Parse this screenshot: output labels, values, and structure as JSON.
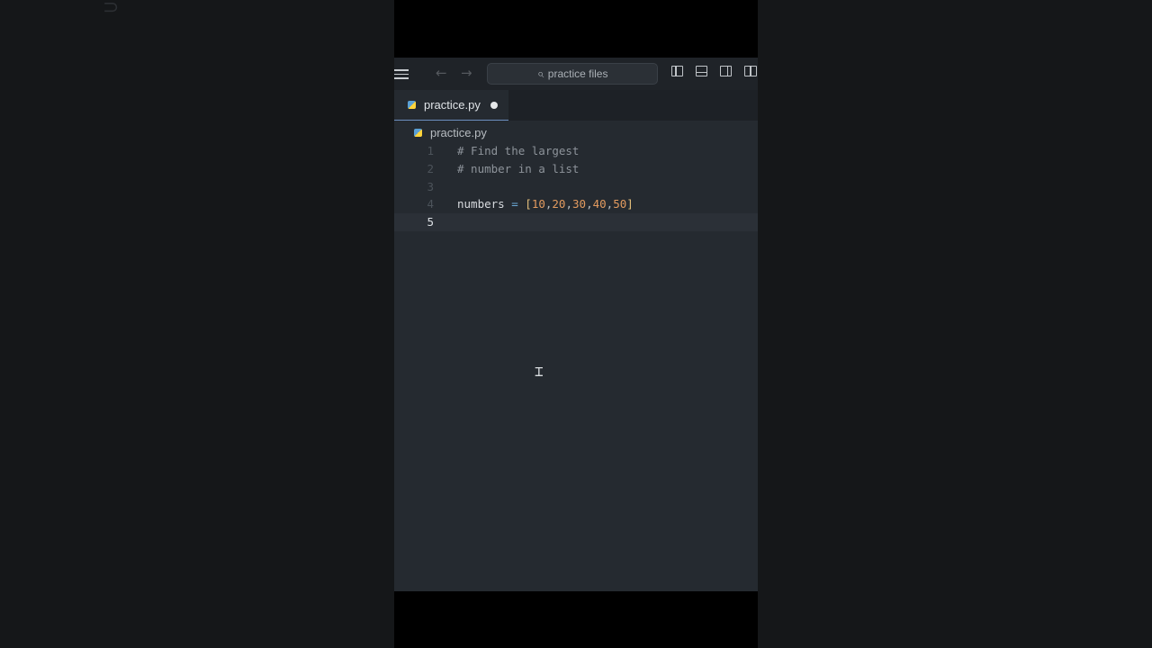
{
  "search": {
    "placeholder_text": "practice files"
  },
  "tab": {
    "label": "practice.py"
  },
  "breadcrumb": {
    "file": "practice.py"
  },
  "editor": {
    "lines": [
      {
        "number": "1",
        "text": "# Find the largest"
      },
      {
        "number": "2",
        "text": "# number in a list"
      },
      {
        "number": "3",
        "text": ""
      },
      {
        "number": "4",
        "ident": "numbers",
        "op": "=",
        "open": "[",
        "values": [
          "10",
          "20",
          "30",
          "40",
          "50"
        ],
        "close": "]"
      },
      {
        "number": "5",
        "text": ""
      }
    ],
    "current_line": "5"
  },
  "colors": {
    "editor_bg": "#252a30",
    "comment": "#8d939a",
    "number": "#e39b5f",
    "bracket": "#e6c07b",
    "operator": "#6aa9d8",
    "tab_underline": "#6c8ebf"
  },
  "icons": [
    "menu-icon",
    "back-arrow-icon",
    "forward-arrow-icon",
    "search-icon",
    "toggle-primary-sidebar-icon",
    "toggle-panel-icon",
    "toggle-secondary-sidebar-icon",
    "customize-layout-icon",
    "python-file-icon",
    "text-cursor-icon"
  ]
}
